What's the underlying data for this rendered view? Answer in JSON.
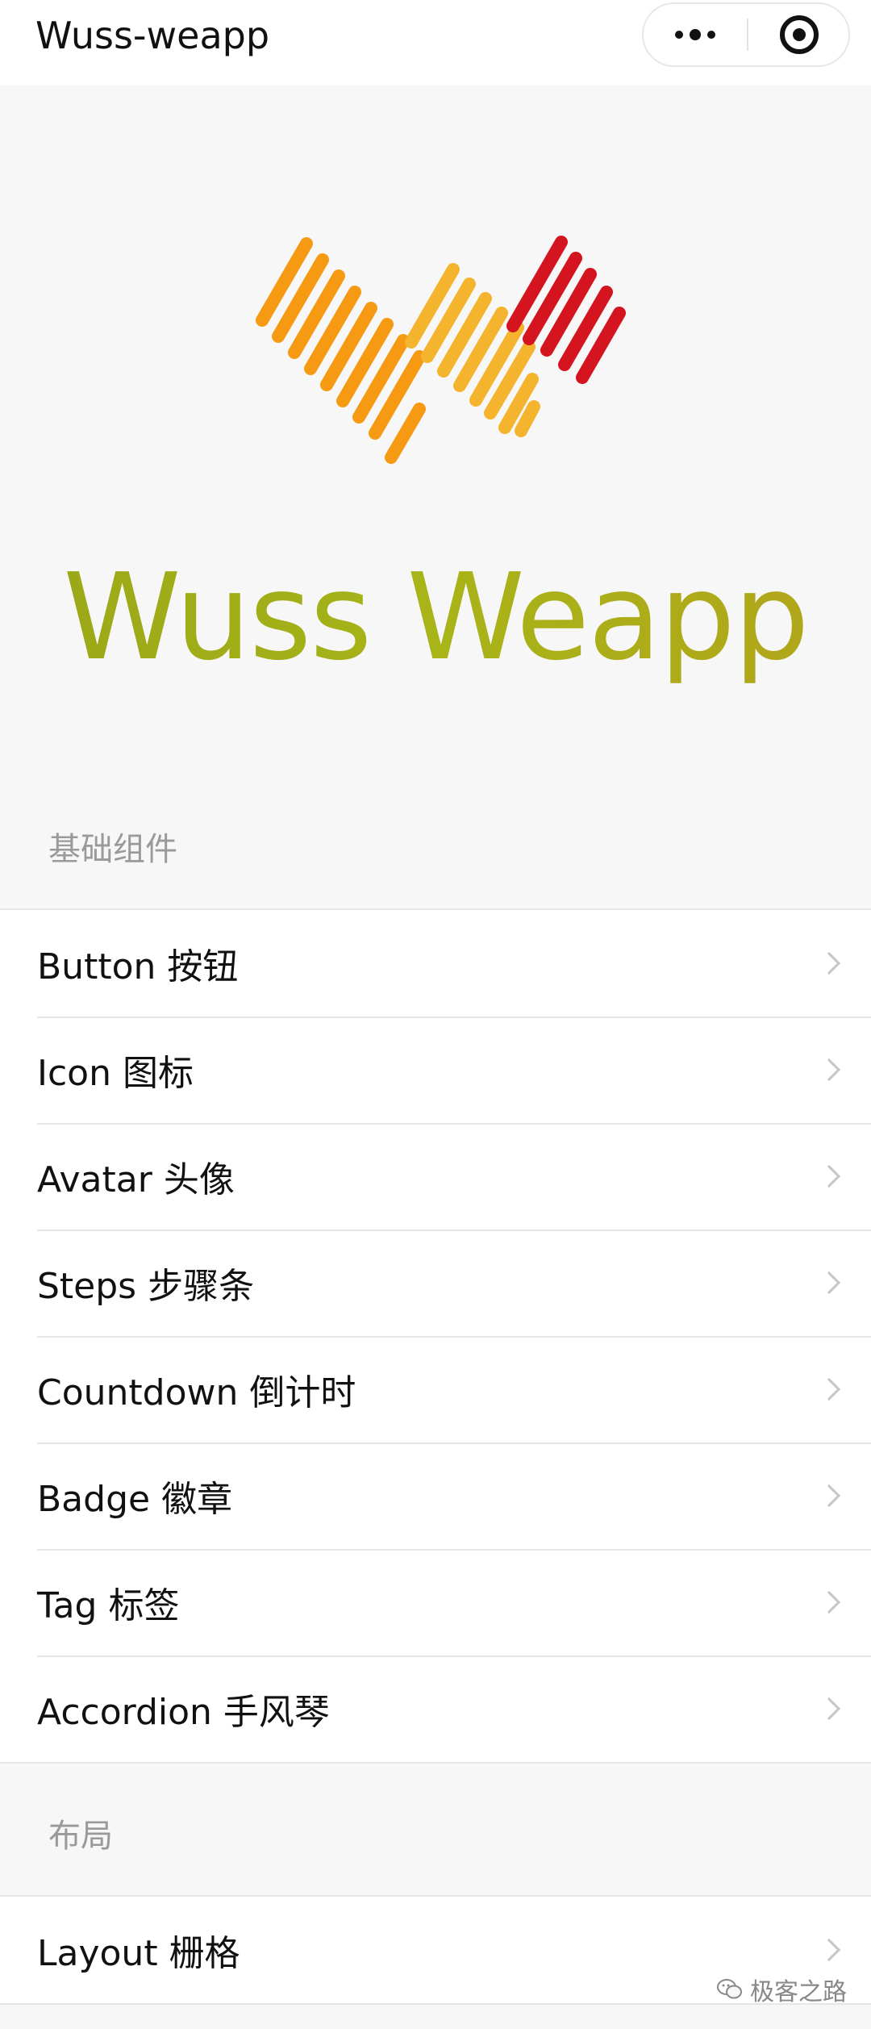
{
  "navbar": {
    "title": "Wuss-weapp",
    "more_icon": "more-dots-icon",
    "close_icon": "target-icon"
  },
  "hero": {
    "brand": "Wuss Weapp",
    "logo_colors": [
      "#f59a12",
      "#f4b42d",
      "#d4151f"
    ],
    "brand_color": "#a3ad16"
  },
  "sections": [
    {
      "title": "基础组件",
      "items": [
        {
          "label": "Button 按钮"
        },
        {
          "label": "Icon 图标"
        },
        {
          "label": "Avatar 头像"
        },
        {
          "label": "Steps 步骤条"
        },
        {
          "label": "Countdown 倒计时"
        },
        {
          "label": "Badge 徽章"
        },
        {
          "label": "Tag 标签"
        },
        {
          "label": "Accordion 手风琴"
        }
      ]
    },
    {
      "title": "布局",
      "items": [
        {
          "label": "Layout 栅格"
        }
      ]
    }
  ],
  "watermark": {
    "text": "极客之路",
    "icon": "wechat-icon"
  }
}
